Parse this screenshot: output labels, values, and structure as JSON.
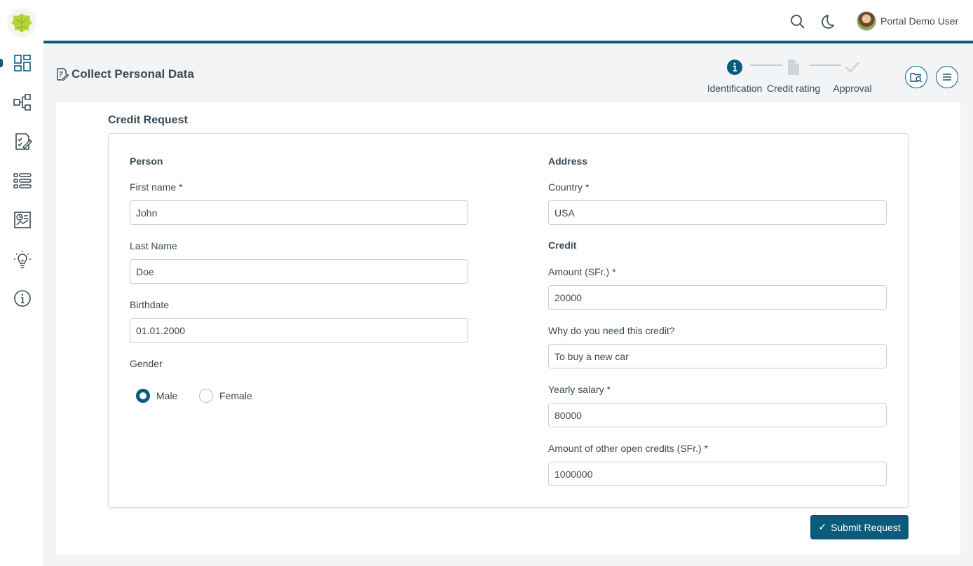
{
  "colors": {
    "accent": "#0b5b7c",
    "text": "#3b4a55",
    "background": "#f2f4f6"
  },
  "sidebar": {
    "items": [
      {
        "icon": "dashboard-icon"
      },
      {
        "icon": "process-icon"
      },
      {
        "icon": "task-icon"
      },
      {
        "icon": "list-icon"
      },
      {
        "icon": "statistics-icon"
      },
      {
        "icon": "idea-icon"
      },
      {
        "icon": "info-icon"
      }
    ]
  },
  "topbar": {
    "user_name": "Portal Demo User",
    "icons": [
      "search-icon",
      "moon-icon"
    ]
  },
  "header": {
    "title": "Collect Personal Data",
    "steps": [
      {
        "label": "Identification",
        "state": "active",
        "icon": "info-icon"
      },
      {
        "label": "Credit rating",
        "state": "pending",
        "icon": "document-icon"
      },
      {
        "label": "Approval",
        "state": "pending",
        "icon": "check-icon"
      }
    ]
  },
  "form": {
    "section_title": "Credit Request",
    "person": {
      "label": "Person",
      "first_name_label": "First name",
      "first_name_value": "John",
      "last_name_label": "Last Name",
      "last_name_value": "Doe",
      "birthdate_label": "Birthdate",
      "birthdate_value": "01.01.2000",
      "gender_label": "Gender",
      "gender_options": [
        "Male",
        "Female"
      ],
      "gender_selected": "Male"
    },
    "address": {
      "label": "Address",
      "country_label": "Country",
      "country_value": "USA"
    },
    "credit": {
      "label": "Credit",
      "amount_label": "Amount (SFr.)",
      "amount_value": "20000",
      "reason_label": "Why do you need this credit?",
      "reason_value": "To buy a new car",
      "salary_label": "Yearly salary",
      "salary_value": "80000",
      "other_label": "Amount of other open credits (SFr.)",
      "other_value": "1000000"
    },
    "required_mark": "*",
    "submit_label": "Submit Request",
    "submit_icon": "✓"
  }
}
